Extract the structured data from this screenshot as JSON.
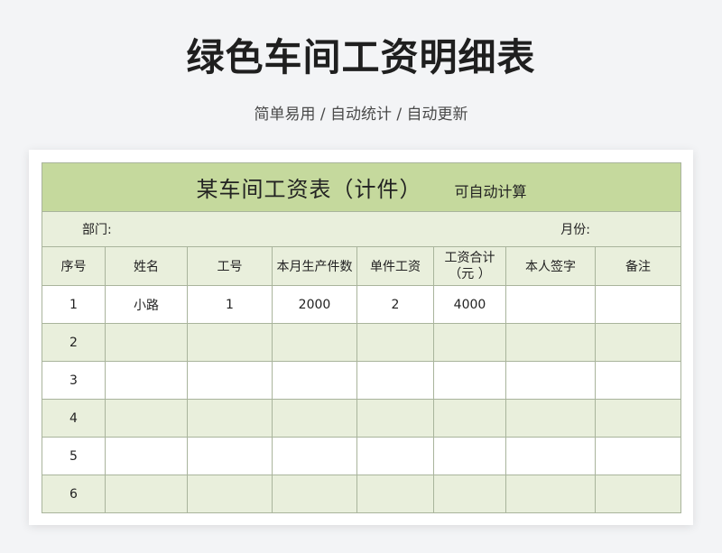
{
  "page": {
    "title": "绿色车间工资明细表",
    "subtitle": "简单易用 / 自动统计 / 自动更新"
  },
  "sheet": {
    "title": "某车间工资表（计件）",
    "note": "可自动计算",
    "department_label": "部门:",
    "month_label": "月份:",
    "headers": [
      "序号",
      "姓名",
      "工号",
      "本月生产件数",
      "单件工资",
      "工资合计（元 ）",
      "本人签字",
      "备注"
    ],
    "rows": [
      [
        "1",
        "小路",
        "1",
        "2000",
        "2",
        "4000",
        "",
        ""
      ],
      [
        "2",
        "",
        "",
        "",
        "",
        "",
        "",
        ""
      ],
      [
        "3",
        "",
        "",
        "",
        "",
        "",
        "",
        ""
      ],
      [
        "4",
        "",
        "",
        "",
        "",
        "",
        "",
        ""
      ],
      [
        "5",
        "",
        "",
        "",
        "",
        "",
        "",
        ""
      ],
      [
        "6",
        "",
        "",
        "",
        "",
        "",
        "",
        ""
      ]
    ]
  },
  "colors": {
    "title_fill": "#c5d99d",
    "band_fill": "#e9efdc",
    "border": "#a9b49c"
  }
}
